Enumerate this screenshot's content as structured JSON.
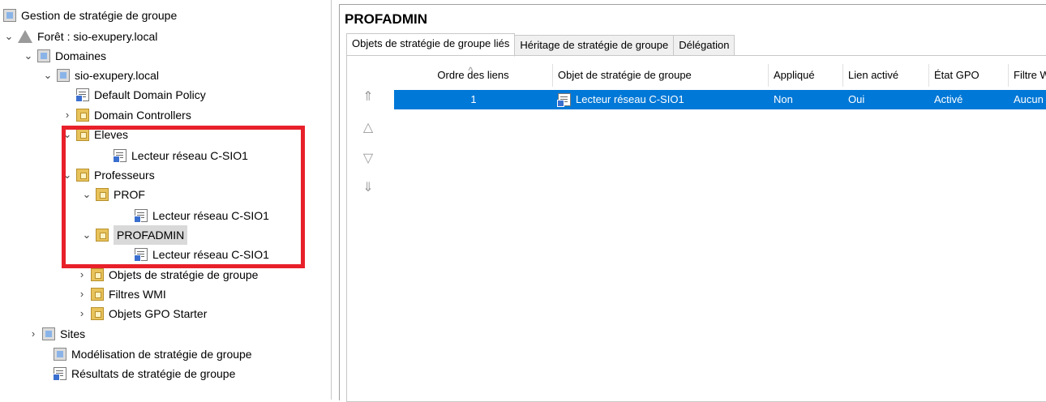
{
  "tree": {
    "root": "Gestion de stratégie de groupe",
    "forest": "Forêt : sio-exupery.local",
    "domains": "Domaines",
    "domain": "sio-exupery.local",
    "default_policy": "Default Domain Policy",
    "domain_controllers": "Domain Controllers",
    "eleves": "Eleves",
    "eleves_gpo": "Lecteur réseau C-SIO1",
    "professeurs": "Professeurs",
    "prof": "PROF",
    "prof_gpo": "Lecteur réseau C-SIO1",
    "profadmin": "PROFADMIN",
    "profadmin_gpo": "Lecteur réseau C-SIO1",
    "gpo_objects": "Objets de stratégie de groupe",
    "wmi_filters": "Filtres WMI",
    "starter_gpos": "Objets GPO Starter",
    "sites": "Sites",
    "modeling": "Modélisation de stratégie de groupe",
    "results": "Résultats de stratégie de groupe"
  },
  "panel": {
    "title": "PROFADMIN",
    "tabs": [
      "Objets de stratégie de groupe liés",
      "Héritage de stratégie de groupe",
      "Délégation"
    ],
    "columns": [
      "Ordre des liens",
      "Objet de stratégie de groupe",
      "Appliqué",
      "Lien activé",
      "État GPO",
      "Filtre W"
    ],
    "rows": [
      {
        "order": "1",
        "gpo": "Lecteur réseau C-SIO1",
        "enforced": "Non",
        "link_enabled": "Oui",
        "status": "Activé",
        "filter": "Aucun"
      }
    ]
  },
  "icons": {
    "move_top": "double-up-arrow-icon",
    "move_up": "up-arrow-icon",
    "move_down": "down-arrow-icon",
    "move_bottom": "double-down-arrow-icon"
  },
  "colors": {
    "selection": "#0078d7",
    "highlight_box": "#e8202a"
  }
}
